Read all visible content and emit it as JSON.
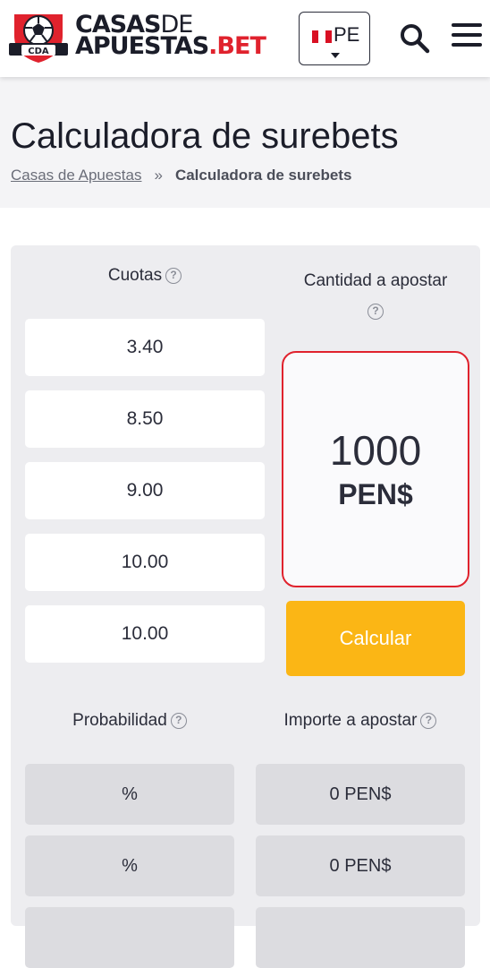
{
  "header": {
    "logo_badge_text": "CDA",
    "logo_line1_a": "CASAS",
    "logo_line1_b": "DE",
    "logo_line2_a": "APUESTAS",
    "logo_line2_b": ".BET",
    "country_code": "PE",
    "search_icon": "search-icon",
    "menu_icon": "hamburger-menu-icon"
  },
  "page": {
    "title": "Calculadora de surebets",
    "breadcrumb": {
      "home": "Casas de Apuestas",
      "separator": "»",
      "current": "Calculadora de surebets"
    }
  },
  "calculator": {
    "odds_header": "Cuotas",
    "stake_header": "Cantidad a apostar",
    "odds": [
      "3.40",
      "8.50",
      "9.00",
      "10.00",
      "10.00"
    ],
    "stake_amount": "1000",
    "stake_currency": "PEN$",
    "calculate_label": "Calcular",
    "probability_header": "Probabilidad",
    "amount_header": "Importe a apostar",
    "results": [
      {
        "probability": "%",
        "amount": "0 PEN$"
      },
      {
        "probability": "%",
        "amount": "0 PEN$"
      }
    ],
    "help_glyph": "?"
  },
  "colors": {
    "brand_red": "#e0222d",
    "accent_yellow": "#fbb615",
    "card_bg": "#ededf0",
    "result_bg": "#dcdce0"
  }
}
